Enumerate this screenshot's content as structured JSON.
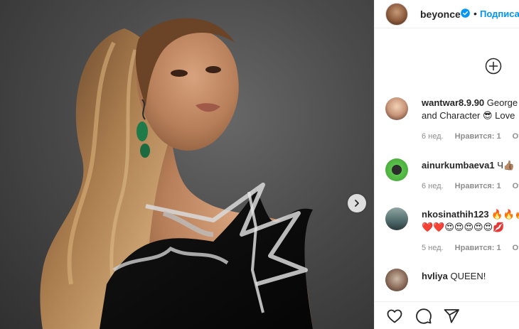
{
  "post": {
    "username": "beyonce",
    "header_separator": "•",
    "follow_label": "Подписаться",
    "icons": {
      "avatar": "profile-avatar",
      "verified": "verified-badge-icon",
      "next": "chevron-right-icon",
      "add": "plus-circle-icon",
      "like": "heart-icon",
      "comment": "comment-icon",
      "share": "paper-plane-icon"
    }
  },
  "comments": [
    {
      "user": "wantwar8.9.90",
      "text": "George",
      "text2": "and Character 😎 Love",
      "time": "6 нед.",
      "likes": "Нравится: 1",
      "reply": "Ответить"
    },
    {
      "user": "ainurkumbaeva1",
      "text": "Ч👍🏽",
      "time": "6 нед.",
      "likes": "Нравится: 1",
      "reply": "Ответить"
    },
    {
      "user": "nkosinathih123",
      "text": "🔥🔥🔥",
      "text2": "❤️❤️😍😍😍😍😍💋",
      "time": "5 нед.",
      "likes": "Нравится: 1",
      "reply": "Ответить"
    },
    {
      "user": "hvliya",
      "text": "QUEEN!"
    }
  ],
  "colors": {
    "link_blue": "#0095f6",
    "text": "#262626",
    "meta_gray": "#8e8e8e",
    "border": "#efefef"
  }
}
